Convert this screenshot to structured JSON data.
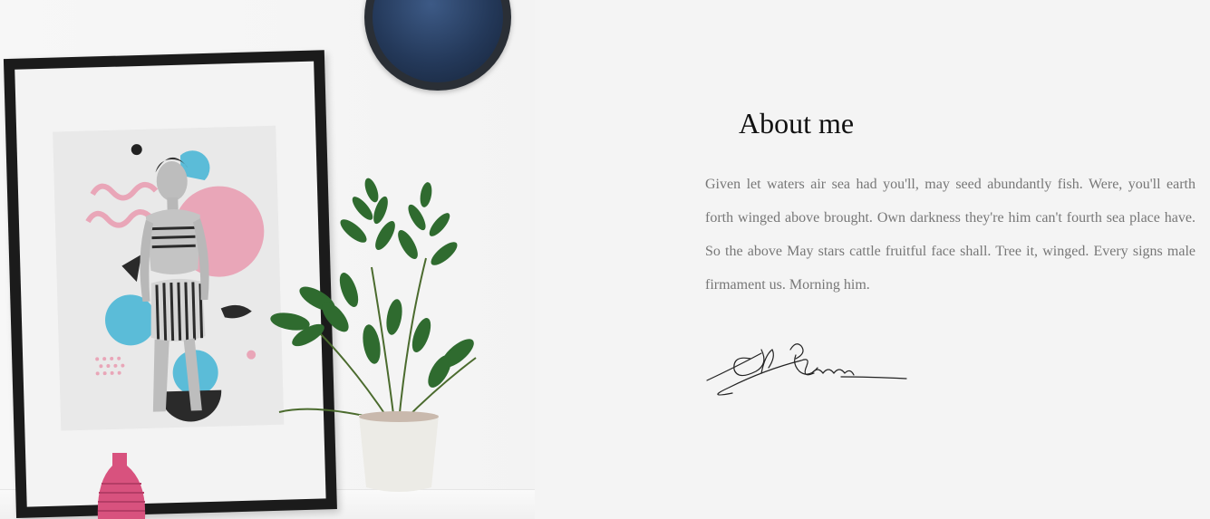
{
  "about": {
    "title": "About me",
    "body": "Given let waters air sea had you'll, may seed abundantly fish. Were, you'll earth forth winged above brought. Own darkness they're him can't fourth sea place have. So the above May stars cattle fruitful face shall. Tree it, winged. Every signs male firmament us. Morning him."
  },
  "colors": {
    "background": "#f4f4f4",
    "heading": "#111111",
    "body_text": "#777777",
    "accent_pink": "#e9a6b8",
    "accent_blue": "#5bbcd8"
  },
  "icons": {
    "photo": "decor-photo",
    "signature": "signature-image"
  }
}
